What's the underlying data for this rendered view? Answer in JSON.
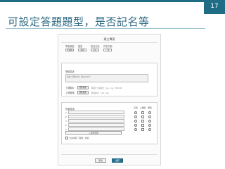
{
  "slide": {
    "number": "17",
    "title": "可設定答題題型，是否記名等"
  },
  "form": {
    "title": "建立專案",
    "selects": [
      {
        "label": "問卷類型",
        "value": "單選題"
      },
      {
        "label": "題型",
        "value": "選項"
      },
      {
        "label": "是否記名",
        "value": "記名"
      },
      {
        "label": "作答次數",
        "value": "一次"
      }
    ],
    "question_label": "問題描述",
    "question_placeholder": "請輸入問題內容（最多200字）",
    "image_label": "上傳圖片",
    "image_button": "選擇檔案",
    "image_note": "建議尺寸與格式：jpg、png，500×300",
    "audio_label": "上傳音檔",
    "audio_button": "選擇檔案",
    "audio_note": "建議格式：mp3、wav",
    "options_label": "答案選項",
    "col_correct": "正解",
    "col_image": "上傳圖",
    "col_delete": "刪除",
    "option_markers": [
      "A",
      "B",
      "C",
      "D",
      "E"
    ],
    "add_option": "+ 新增選項",
    "allow_other": "允許填寫「其他」答案",
    "cancel": "取消",
    "save": "儲存"
  }
}
